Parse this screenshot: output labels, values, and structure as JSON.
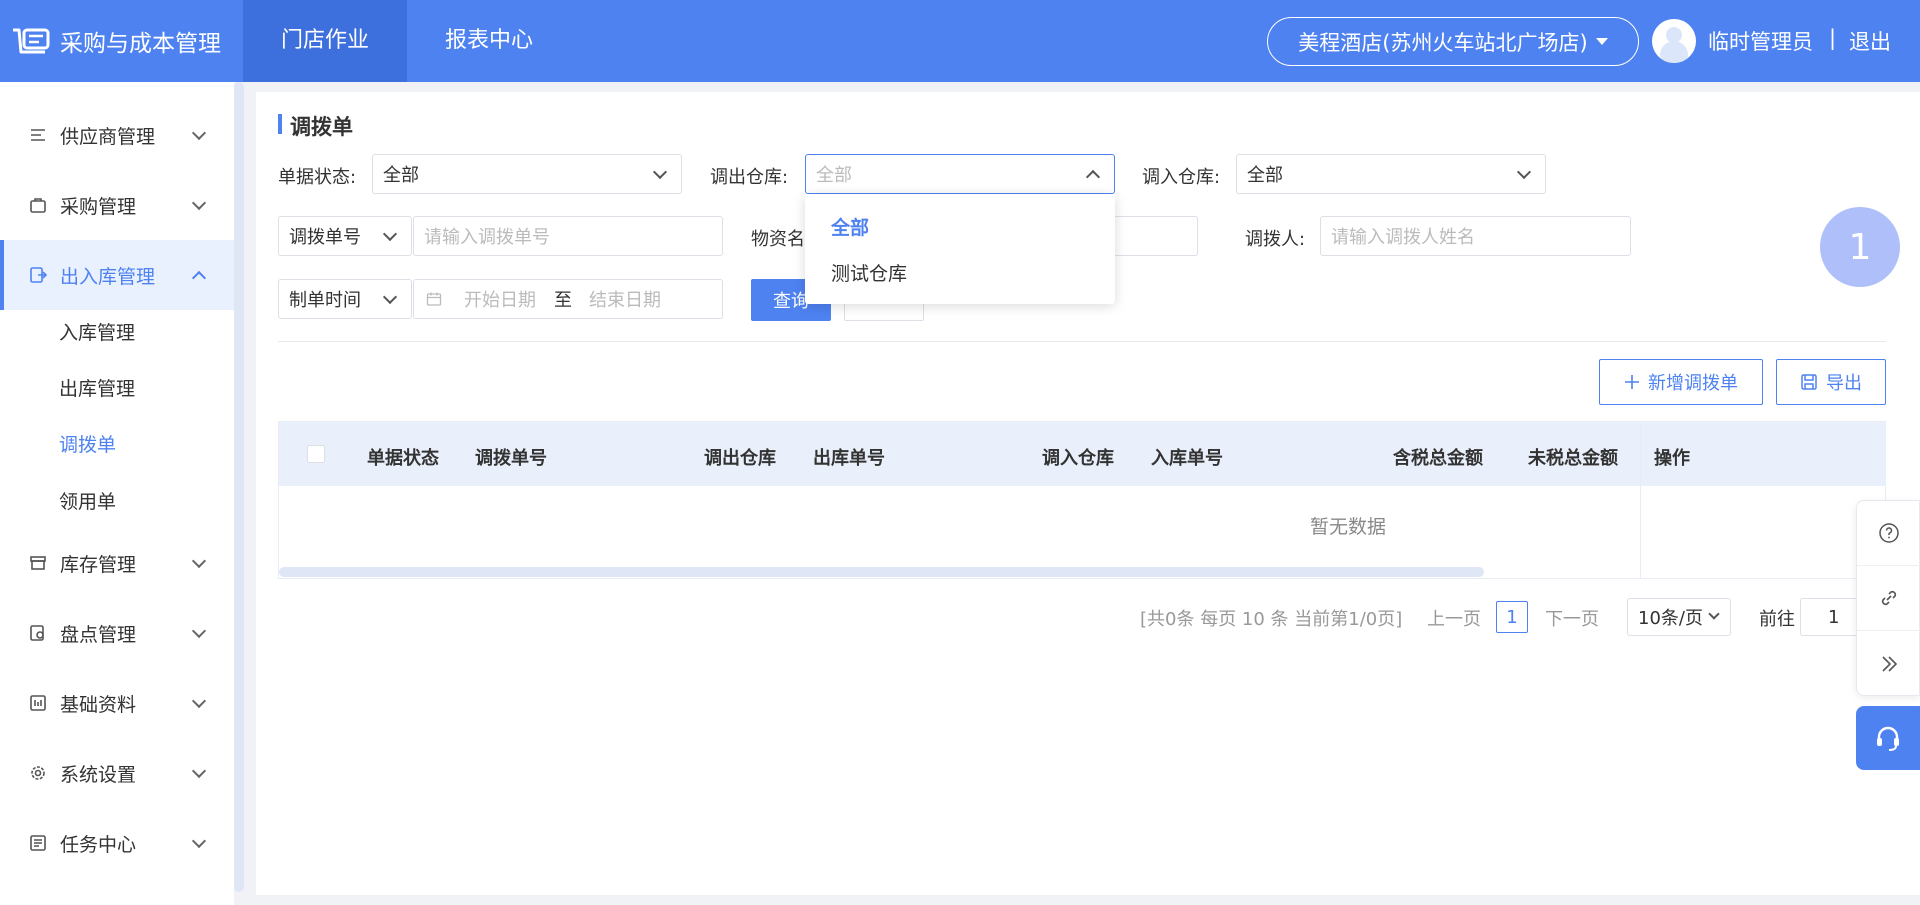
{
  "header": {
    "app_title": "采购与成本管理",
    "nav": [
      "门店作业",
      "报表中心"
    ],
    "store": "美程酒店(苏州火车站北广场店)",
    "user": "临时管理员",
    "separator": "|",
    "logout": "退出"
  },
  "sidebar": {
    "items": [
      {
        "label": "供应商管理",
        "icon": "supplier-icon"
      },
      {
        "label": "采购管理",
        "icon": "purchase-icon"
      },
      {
        "label": "出入库管理",
        "icon": "stock-io-icon"
      },
      {
        "label": "库存管理",
        "icon": "inventory-icon"
      },
      {
        "label": "盘点管理",
        "icon": "stocktake-icon"
      },
      {
        "label": "基础资料",
        "icon": "basic-data-icon"
      },
      {
        "label": "系统设置",
        "icon": "gear-icon"
      },
      {
        "label": "任务中心",
        "icon": "task-icon"
      }
    ],
    "sub_items": [
      "入库管理",
      "出库管理",
      "调拨单",
      "领用单"
    ]
  },
  "page": {
    "title": "调拨单"
  },
  "filters": {
    "status_label": "单据状态:",
    "status_value": "全部",
    "out_wh_label": "调出仓库:",
    "out_wh_placeholder": "全部",
    "in_wh_label": "调入仓库:",
    "in_wh_value": "全部",
    "no_type": "调拨单号",
    "no_placeholder": "请输入调拨单号",
    "material_label": "物资名",
    "person_label": "调拨人:",
    "person_placeholder": "请输入调拨人姓名",
    "time_type": "制单时间",
    "start_placeholder": "开始日期",
    "to": "至",
    "end_placeholder": "结束日期",
    "query": "查询"
  },
  "dropdown": {
    "options": [
      "全部",
      "测试仓库"
    ],
    "selected": "全部"
  },
  "toolbar": {
    "add": "新增调拨单",
    "export": "导出"
  },
  "table": {
    "columns": [
      "单据状态",
      "调拨单号",
      "调出仓库",
      "出库单号",
      "调入仓库",
      "入库单号",
      "含税总金额",
      "未税总金额",
      "操作"
    ],
    "empty": "暂无数据"
  },
  "pagination": {
    "summary": "[共0条 每页 10 条 当前第1/0页]",
    "prev": "上一页",
    "current": "1",
    "next": "下一页",
    "page_size": "10条/页",
    "goto_label": "前往",
    "goto_value": "1"
  },
  "badge": "1",
  "colors": {
    "primary": "#4e82f1",
    "header_active": "#3d6fdd",
    "badge": "#aebffa"
  }
}
